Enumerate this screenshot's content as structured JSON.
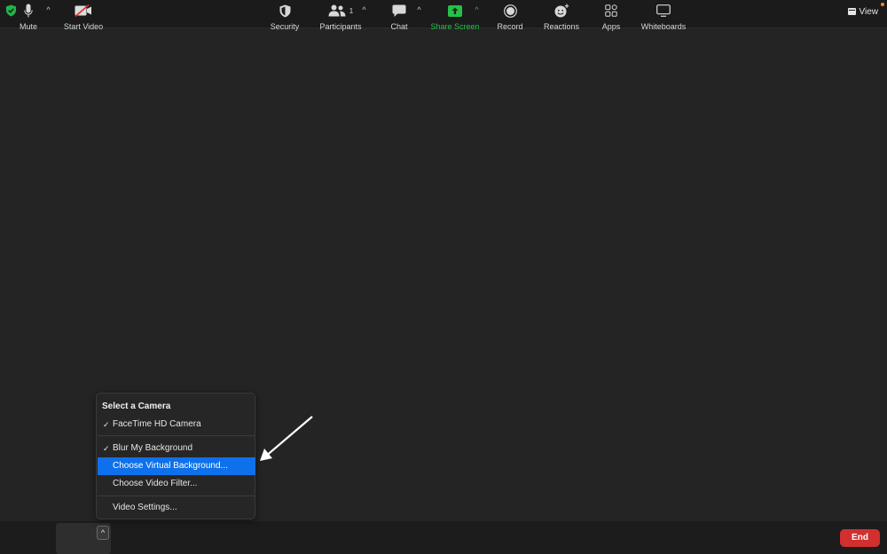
{
  "titlebar": {
    "view_label": "View"
  },
  "camera_menu": {
    "header": "Select a Camera",
    "items": [
      {
        "label": "FaceTime HD Camera",
        "checked": true,
        "highlighted": false
      },
      {
        "label": "Blur My Background",
        "checked": true,
        "highlighted": false
      },
      {
        "label": "Choose Virtual Background...",
        "checked": false,
        "highlighted": true
      },
      {
        "label": "Choose Video Filter...",
        "checked": false,
        "highlighted": false
      },
      {
        "label": "Video Settings...",
        "checked": false,
        "highlighted": false
      }
    ],
    "check_glyph": "✓"
  },
  "toolbar": {
    "mute": "Mute",
    "start_video": "Start Video",
    "security": "Security",
    "participants": "Participants",
    "participants_count": "1",
    "chat": "Chat",
    "share_screen": "Share Screen",
    "record": "Record",
    "reactions": "Reactions",
    "apps": "Apps",
    "whiteboards": "Whiteboards",
    "end": "End",
    "caret_glyph": "^"
  },
  "colors": {
    "accent_blue": "#0e71eb",
    "share_green": "#24c146",
    "end_red": "#d22f2f",
    "shield_green": "#23b24b"
  },
  "icons": {
    "titlebar_left": "shield-check-icon",
    "view": "calendar-grid-icon",
    "mute": "microphone-icon",
    "start_video": "video-off-icon",
    "security": "shield-icon",
    "participants": "people-icon",
    "chat": "chat-bubble-icon",
    "share_screen": "share-up-arrow-icon",
    "record": "record-icon",
    "reactions": "smile-plus-icon",
    "apps": "apps-icon",
    "whiteboards": "whiteboard-icon"
  }
}
